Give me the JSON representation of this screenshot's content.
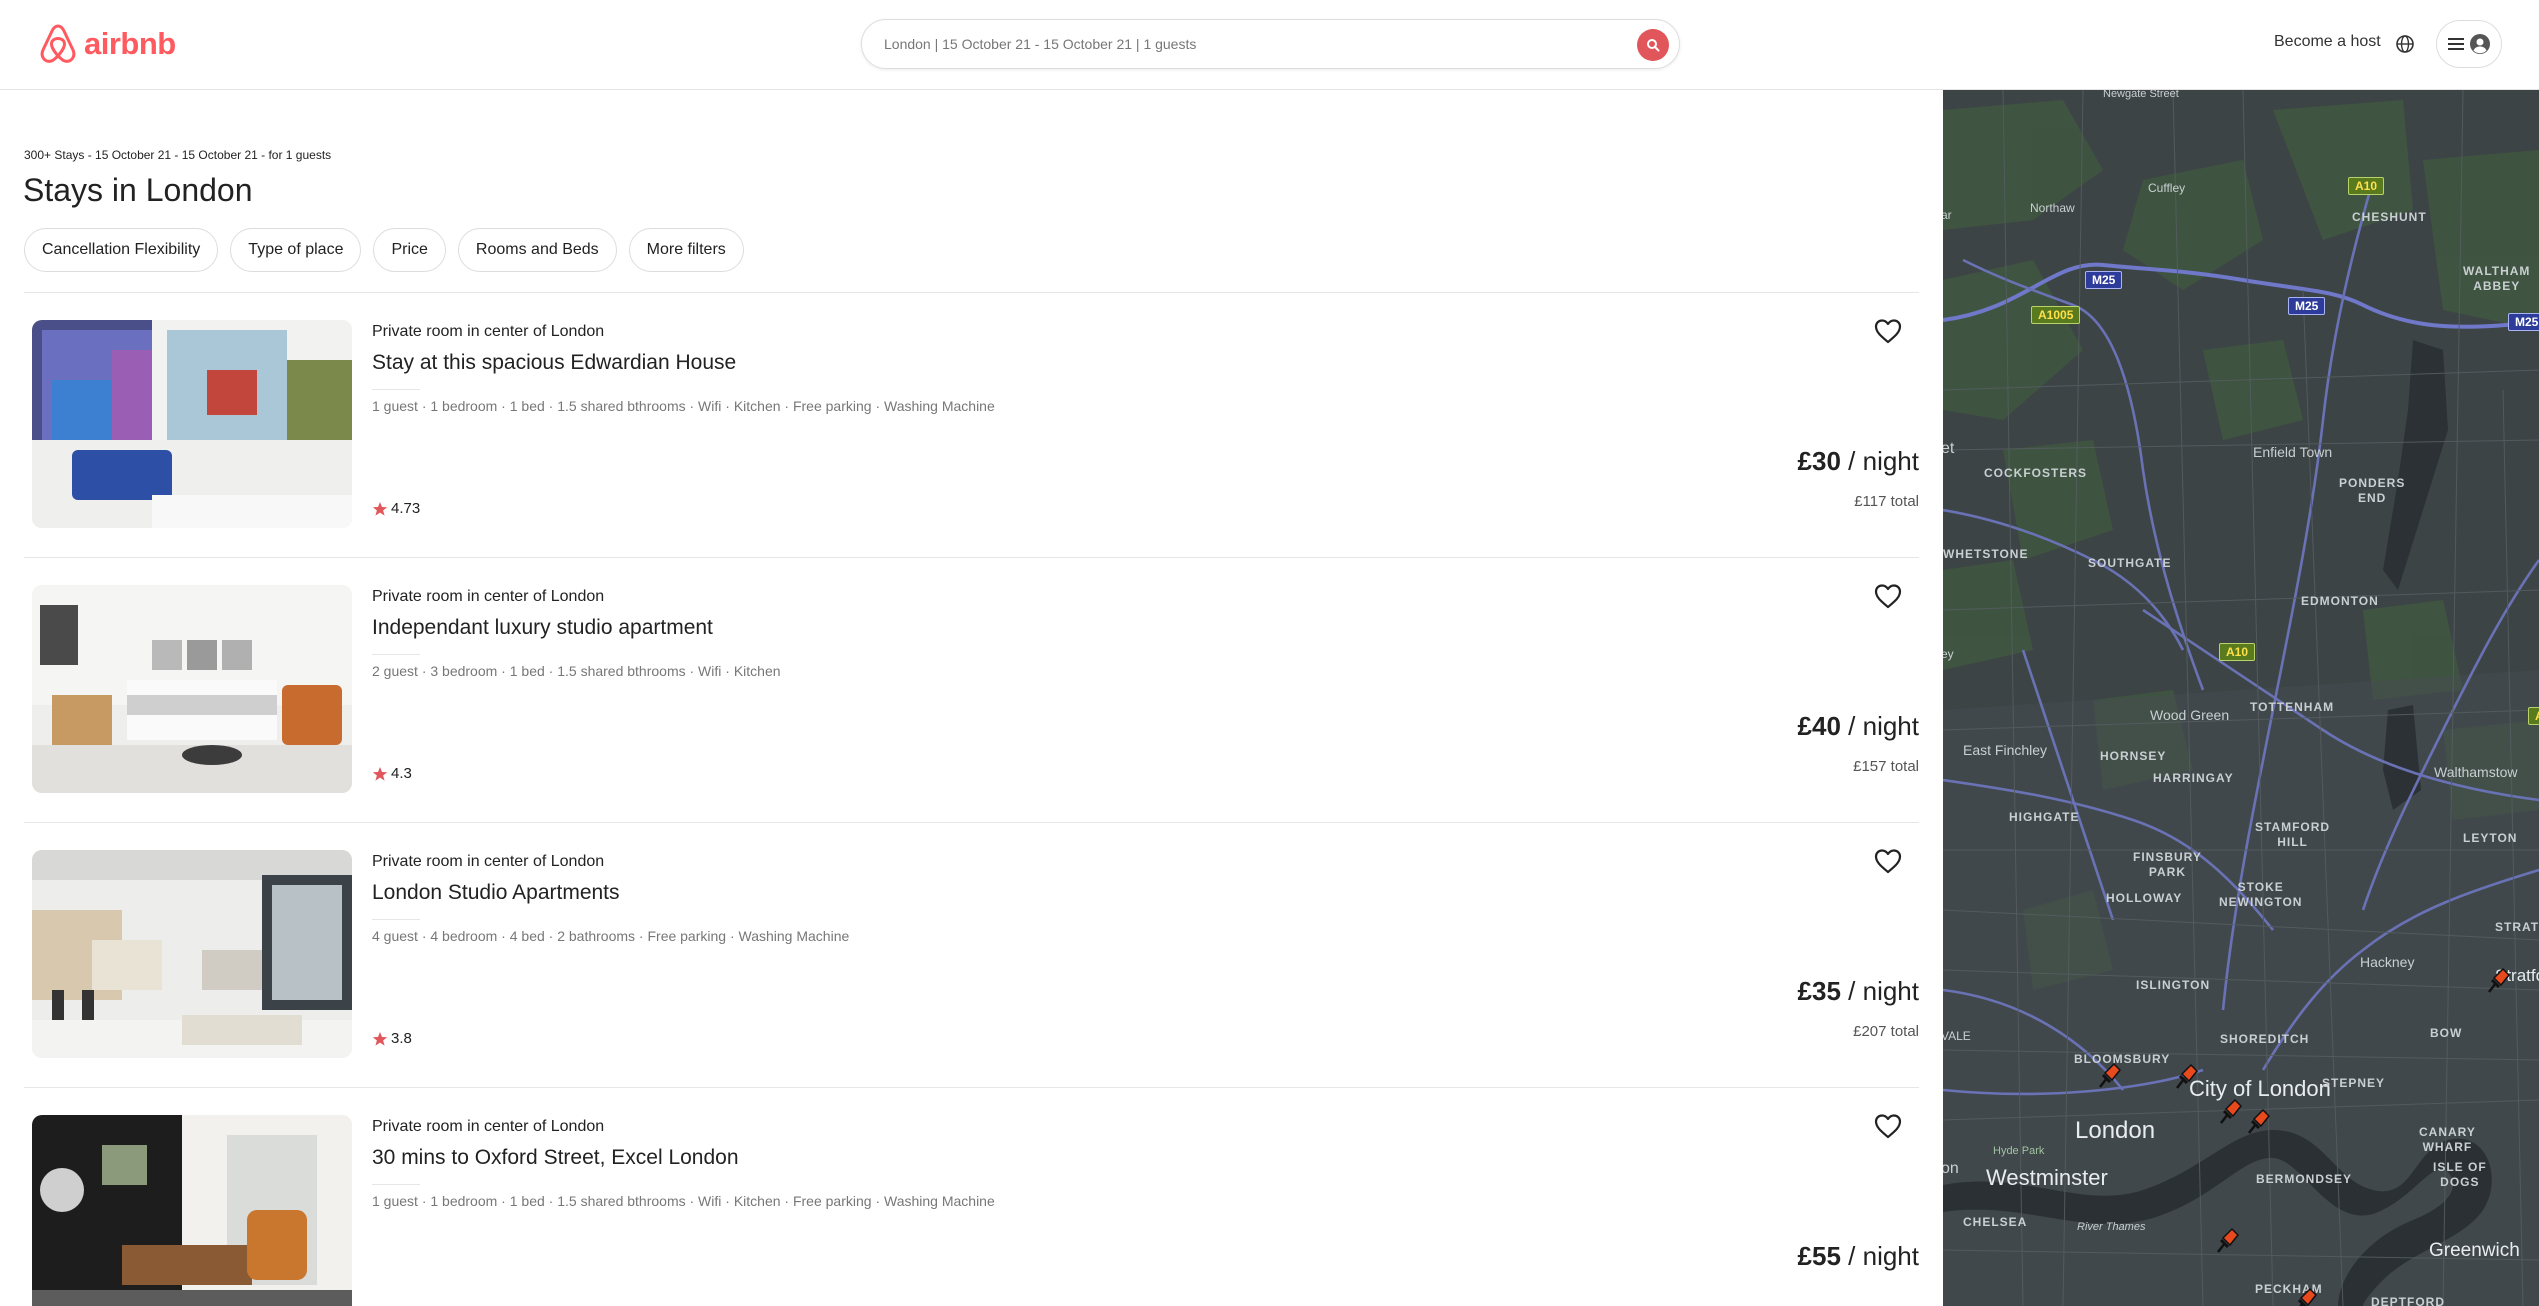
{
  "header": {
    "logo_text": "airbnb",
    "search_text": "London | 15 October 21 - 15 October 21 | 1 guests",
    "become_host": "Become a host",
    "brand_color": "#ff5a5f"
  },
  "results": {
    "summary": "300+ Stays - 15 October 21 - 15 October 21 - for 1 guests",
    "title": "Stays in London"
  },
  "filters": [
    {
      "label": "Cancellation Flexibility"
    },
    {
      "label": "Type of place"
    },
    {
      "label": "Price"
    },
    {
      "label": "Rooms and Beds"
    },
    {
      "label": "More filters"
    }
  ],
  "listings": [
    {
      "subtitle": "Private room in center of London",
      "title": "Stay at this spacious Edwardian House",
      "amenities": "1 guest · 1 bedroom · 1 bed · 1.5 shared bthrooms · Wifi · Kitchen · Free parking · Washing Machine",
      "rating": "4.73",
      "price": "£30",
      "price_unit": " / night",
      "total": "£117 total"
    },
    {
      "subtitle": "Private room in center of London",
      "title": "Independant luxury studio apartment",
      "amenities": "2 guest · 3 bedroom · 1 bed · 1.5 shared bthrooms · Wifi · Kitchen",
      "rating": "4.3",
      "price": "£40",
      "price_unit": " / night",
      "total": "£157 total"
    },
    {
      "subtitle": "Private room in center of London",
      "title": "London Studio Apartments",
      "amenities": "4 guest · 4 bedroom · 4 bed · 2 bathrooms · Free parking · Washing Machine",
      "rating": "3.8",
      "price": "£35",
      "price_unit": " / night",
      "total": "£207 total"
    },
    {
      "subtitle": "Private room in center of London",
      "title": "30 mins to Oxford Street, Excel London",
      "amenities": "1 guest · 1 bedroom · 1 bed · 1.5 shared bthrooms · Wifi · Kitchen · Free parking · Washing Machine",
      "rating": "",
      "price": "£55",
      "price_unit": " / night",
      "total": ""
    }
  ],
  "map": {
    "labels": {
      "newgate_street": "Newgate Street",
      "northaw": "Northaw",
      "cuffley": "Cuffley",
      "cheshunt": "CHESHUNT",
      "waltham_abbey": "WALTHAM\nABBEY",
      "cockfosters": "COCKFOSTERS",
      "enfield_town": "Enfield Town",
      "ponders_end": "PONDERS\nEND",
      "whetstone": "WHETSTONE",
      "southgate": "SOUTHGATE",
      "edmonton": "EDMONTON",
      "wood_green": "Wood Green",
      "tottenham": "TOTTENHAM",
      "east_finchley": "East Finchley",
      "hornsey": "HORNSEY",
      "walthamstow": "Walthamstow",
      "harringay": "HARRINGAY",
      "highgate": "HIGHGATE",
      "stamford_hill": "STAMFORD\nHILL",
      "leyton": "LEYTON",
      "finsbury_park": "FINSBURY\nPARK",
      "holloway": "HOLLOWAY",
      "stoke_newington": "STOKE\nNEWINGTON",
      "stratford": "STRATFORD",
      "hackney": "Hackney",
      "stratford_town": "Stratford",
      "islington": "ISLINGTON",
      "bloomsbury": "BLOOMSBURY",
      "shoreditch": "SHOREDITCH",
      "bow": "BOW",
      "city_of_london": "City of London",
      "stepney": "STEPNEY",
      "london": "London",
      "hyde_park": "Hyde Park",
      "canary_wharf": "CANARY\nWHARF",
      "westminster": "Westminster",
      "bermondsey": "BERMONDSEY",
      "isle_of_dogs": "ISLE OF\nDOGS",
      "chelsea": "CHELSEA",
      "river_thames": "River Thames",
      "greenwich": "Greenwich",
      "peckham": "PECKHAM",
      "deptford": "DEPTFORD",
      "edge_ar": "ar",
      "edge_et": "et",
      "edge_ey": "ey",
      "edge_vale": "VALE",
      "edge_on": "on"
    },
    "roads": {
      "a10_top": "A10",
      "m25_left": "M25",
      "m25_mid": "M25",
      "m25_right": "M25",
      "a1005": "A1005",
      "a10_mid": "A10",
      "a_right": "A"
    },
    "pin_color": "#e8491d"
  }
}
